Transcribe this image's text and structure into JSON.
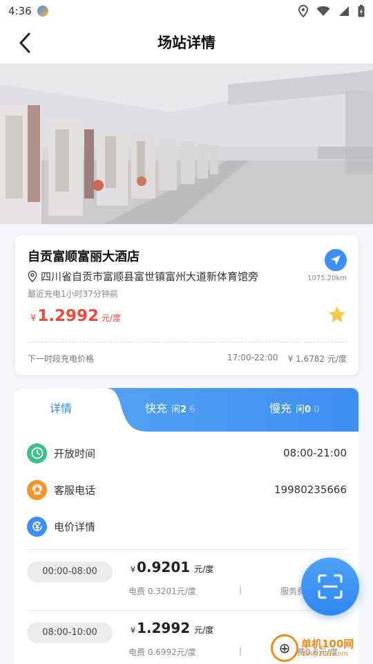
{
  "status_bar": {
    "time": "4:36"
  },
  "header": {
    "title": "场站详情"
  },
  "station": {
    "name": "自贡富顺富丽大酒店",
    "address": "四川省自贡市富顺县富世镇富州大道新体育馆旁",
    "last_charge": "最近充电1小时37分钟前",
    "currency": "¥",
    "price": "1.2992",
    "price_unit": "元/度",
    "distance": "1075.20km",
    "next_period_label": "下一时段充电价格",
    "next_period_time": "17:00-22:00",
    "next_period_price": "¥ 1.6782 元/度"
  },
  "tabs": {
    "detail": "详情",
    "fast": {
      "label": "快充",
      "idle_label": "闲",
      "idle": "2",
      "total": "6"
    },
    "slow": {
      "label": "慢充",
      "idle_label": "闲",
      "idle": "0",
      "total": "0"
    }
  },
  "info": {
    "open_hours": {
      "label": "开放时间",
      "value": "08:00-21:00"
    },
    "service_phone": {
      "label": "客服电话",
      "value": "19980235666"
    },
    "price_detail": {
      "label": "电价详情"
    }
  },
  "periods": [
    {
      "time": "00:00-08:00",
      "currency": "¥",
      "price": "0.9201",
      "unit": "元/度",
      "elec": "电费 0.3201元/度",
      "sep": "|",
      "service": "服务费0.6元/度"
    },
    {
      "time": "08:00-10:00",
      "currency": "¥",
      "price": "1.2992",
      "unit": "元/度",
      "elec": "电费 0.6992元/度",
      "sep": "|",
      "service": "服务费0.6元/度"
    }
  ],
  "watermark": {
    "name": "单机100网",
    "url": "danji100.com"
  },
  "colors": {
    "accent": "#3e8ff4",
    "price_red": "#e84c3d",
    "star": "#f5c94a",
    "green": "#3fbf8a",
    "orange": "#f0962b"
  }
}
